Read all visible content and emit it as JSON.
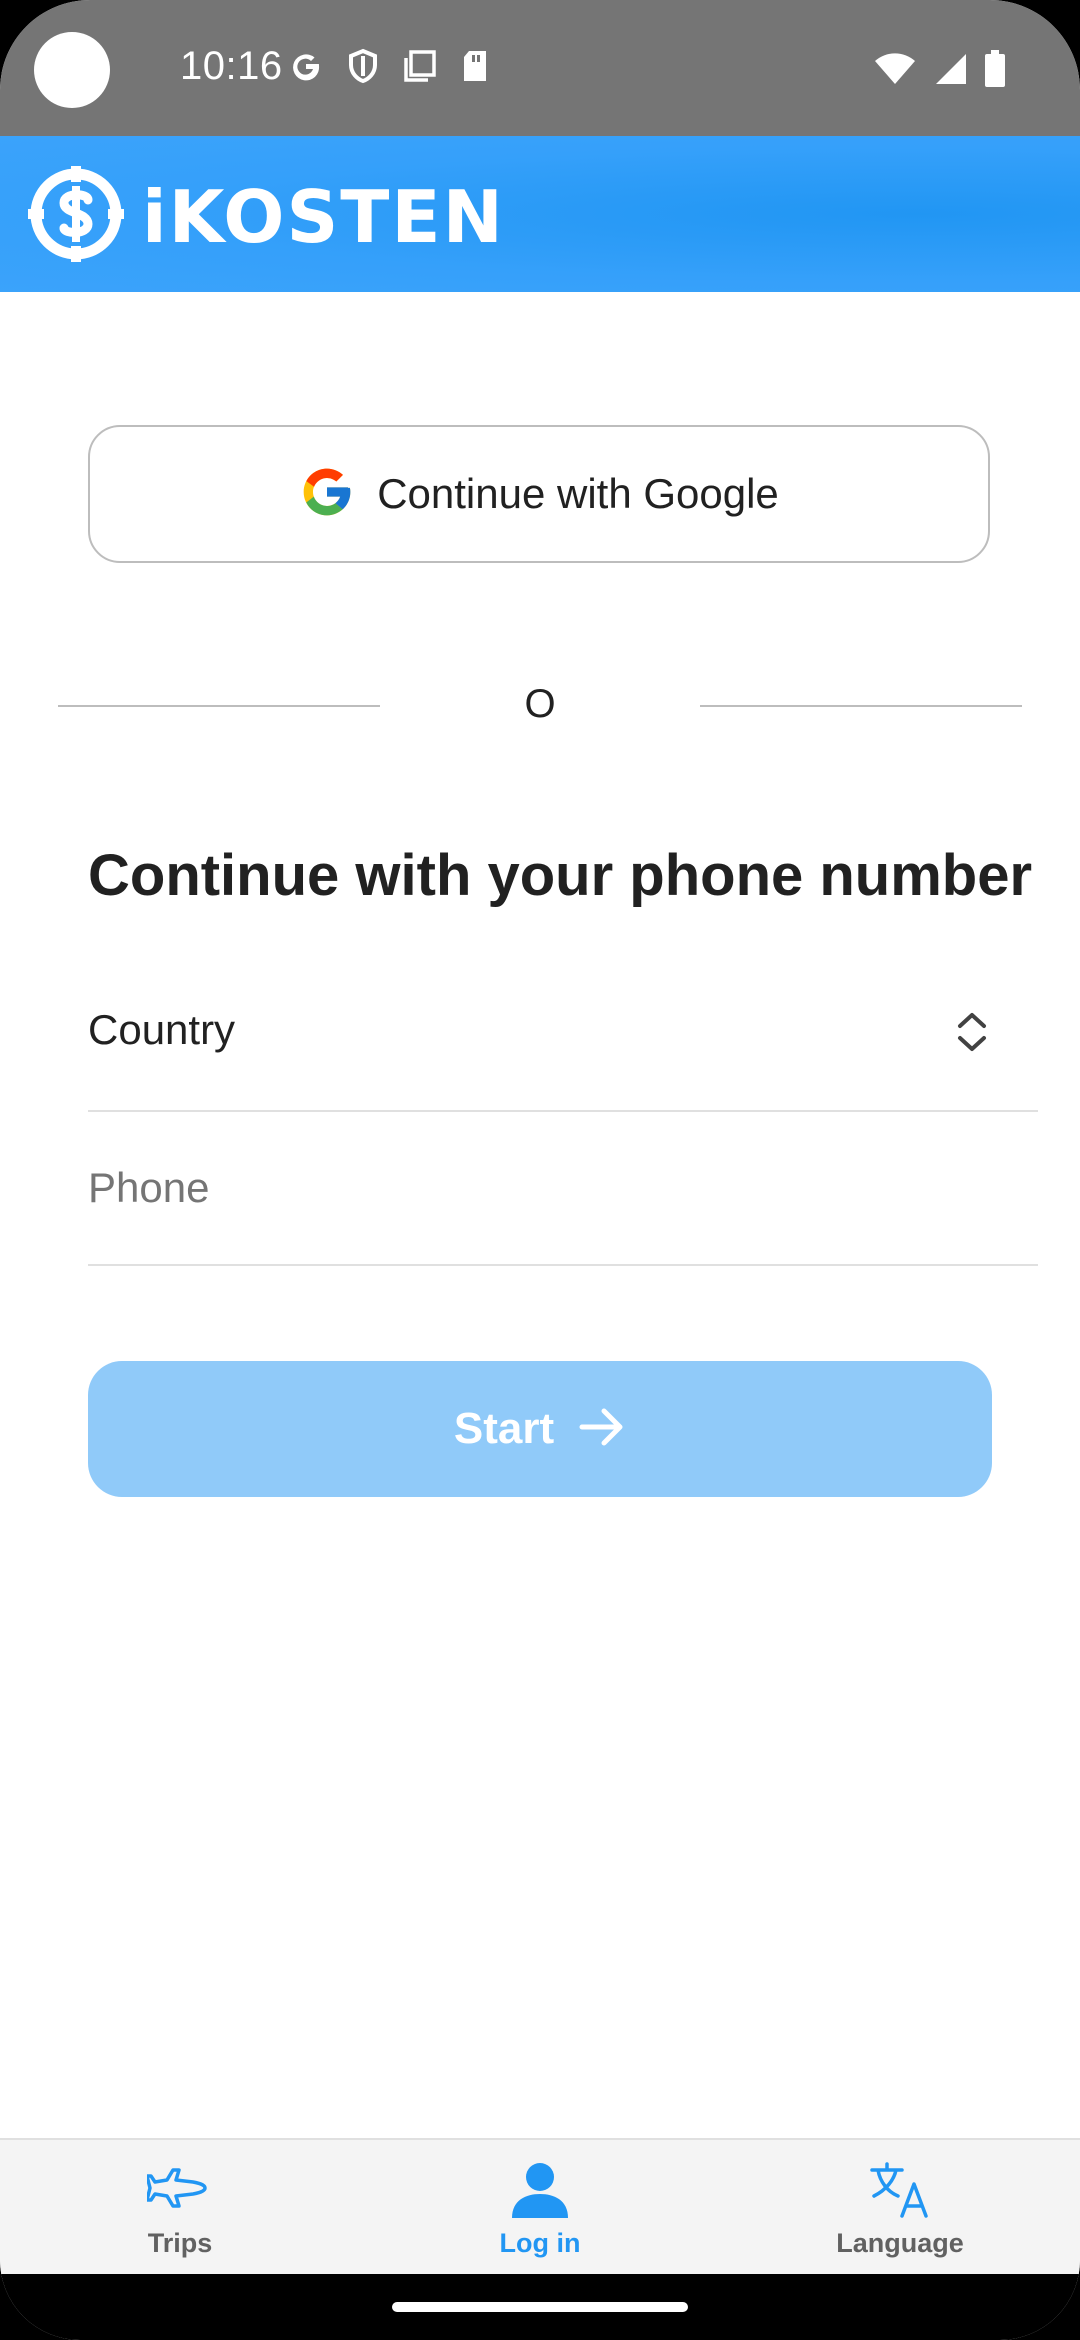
{
  "status_bar": {
    "time": "10:16",
    "left_icons": [
      "google-icon",
      "shield-icon",
      "screenshot-icon",
      "sd-card-icon"
    ],
    "right_icons": [
      "wifi-icon",
      "signal-icon",
      "battery-icon"
    ]
  },
  "app_bar": {
    "brand": "iKOSTEN",
    "brand_color": "#2196f3"
  },
  "google_button": {
    "label": "Continue with Google"
  },
  "divider": {
    "text": "O"
  },
  "phone_form": {
    "heading": "Continue with your phone number",
    "country_label": "Country",
    "phone_placeholder": "Phone",
    "start_label": "Start",
    "start_color": "#90caf9"
  },
  "bottom_nav": {
    "items": [
      {
        "label": "Trips",
        "icon": "airplane-icon",
        "color": "#616161"
      },
      {
        "label": "Log in",
        "icon": "person-icon",
        "color": "#2196f3",
        "active": true
      },
      {
        "label": "Language",
        "icon": "translate-icon",
        "color": "#616161"
      }
    ]
  }
}
